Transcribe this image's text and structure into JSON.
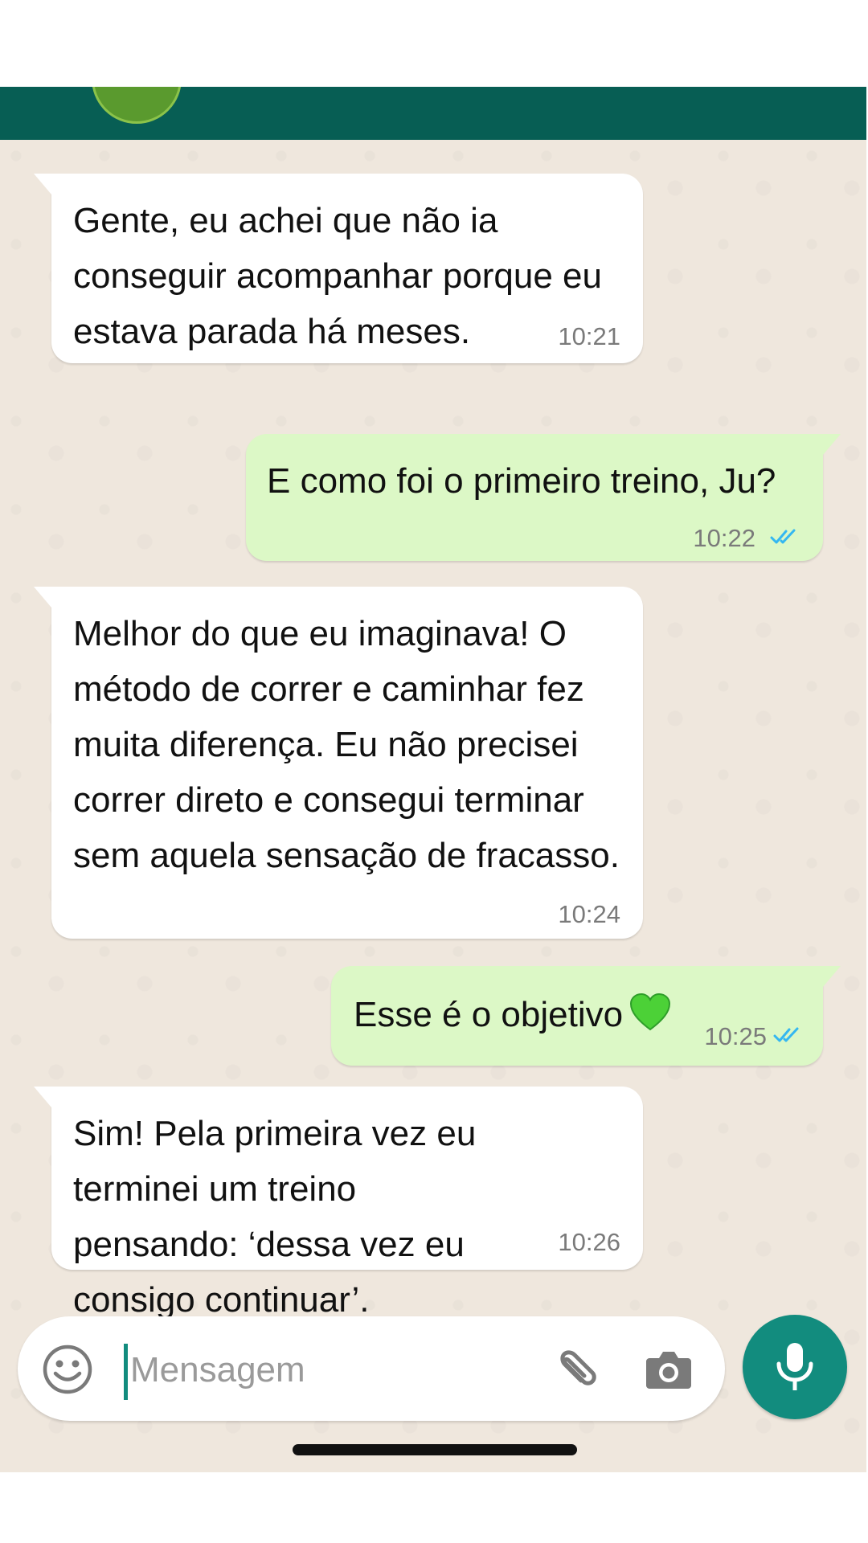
{
  "messages": [
    {
      "direction": "incoming",
      "text": "Gente, eu achei que não ia conseguir acompanhar porque eu estava parada há meses.",
      "time": "10:21"
    },
    {
      "direction": "outgoing",
      "text": "E como foi o primeiro treino, Ju?",
      "time": "10:22",
      "status": "read"
    },
    {
      "direction": "incoming",
      "text": "Melhor do que eu imaginava! O método de correr e caminhar fez muita diferença. Eu não precisei correr direto e consegui terminar sem aquela sensação de fracasso.",
      "time": "10:24"
    },
    {
      "direction": "outgoing",
      "text": "Esse é o objetivo",
      "emoji": "green-heart",
      "time": "10:25",
      "status": "read"
    },
    {
      "direction": "incoming",
      "text": "Sim! Pela primeira vez eu terminei um treino pensando: ‘dessa vez eu consigo continuar’.",
      "time": "10:26"
    }
  ],
  "composer": {
    "placeholder": "Mensagem",
    "value": ""
  },
  "icons": {
    "emoji": "emoji-icon",
    "attach": "paperclip-icon",
    "camera": "camera-icon",
    "mic": "mic-icon",
    "read_receipt": "double-check-icon"
  },
  "colors": {
    "header": "#075e54",
    "incoming_bubble": "#ffffff",
    "outgoing_bubble": "#dcf8c6",
    "chat_background": "#efe7dd",
    "accent": "#128c7e",
    "read_ticks": "#34b7f1"
  }
}
